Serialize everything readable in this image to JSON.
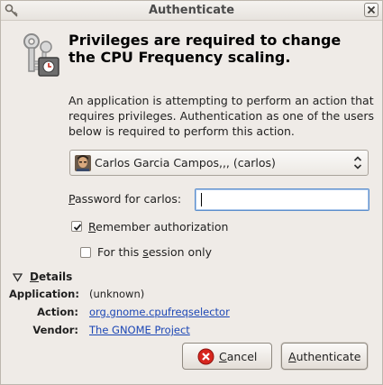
{
  "window": {
    "title": "Authenticate"
  },
  "dialog": {
    "heading": "Privileges are required to change the CPU Frequency scaling.",
    "description": "An application is attempting to perform an action that requires privileges. Authentication as one of the users below is required to perform this action."
  },
  "user_select": {
    "selected": "Carlos Garcia Campos,,, (carlos)"
  },
  "password": {
    "label_accel": "P",
    "label_rest": "assword for carlos:",
    "value": ""
  },
  "remember": {
    "accel": "R",
    "rest": "emember authorization",
    "checked": true
  },
  "session_only": {
    "pre": "For this ",
    "accel": "s",
    "rest": "ession only",
    "checked": false
  },
  "details": {
    "toggle_accel": "D",
    "toggle_rest": "etails",
    "expanded": true,
    "rows": [
      {
        "key": "Application:",
        "value": "(unknown)",
        "link": false
      },
      {
        "key": "Action:",
        "value": "org.gnome.cpufreqselector",
        "link": true
      },
      {
        "key": "Vendor:",
        "value": "The GNOME Project",
        "link": true
      }
    ]
  },
  "buttons": {
    "cancel_accel": "C",
    "cancel_rest": "ancel",
    "auth_accel": "A",
    "auth_rest": "uthenticate"
  },
  "colors": {
    "link": "#1b46b5",
    "focus_border": "#5d8fcc",
    "cancel_icon": "#d7261e"
  },
  "icons": {
    "title": "keys-icon",
    "dialog": "keys-padlock-icon",
    "close": "close-icon",
    "cancel": "cancel-icon",
    "avatar": "user-avatar"
  }
}
